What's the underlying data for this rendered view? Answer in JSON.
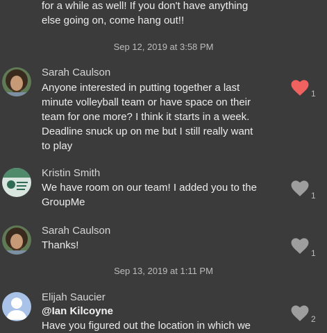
{
  "messages": [
    {
      "text_lines": [
        "for a while as well! If you don't have anything",
        "else going on, come hang out!!"
      ]
    },
    {
      "timestamp": "Sep 12, 2019 at 3:58 PM",
      "sender": "Sarah Caulson",
      "text_lines": [
        "Anyone interested in putting together a last",
        "minute volleyball team or have space on their",
        "team for one more? I think it starts in a week.",
        "Deadline snuck up on me but I still really want",
        "to play"
      ],
      "likes": "1",
      "liked": true
    },
    {
      "sender": "Kristin Smith",
      "text_lines": [
        "We have room on our team! I added you to the",
        "GroupMe"
      ],
      "likes": "1",
      "liked": false
    },
    {
      "sender": "Sarah Caulson",
      "text_lines": [
        "Thanks!"
      ],
      "likes": "1",
      "liked": false
    },
    {
      "timestamp": "Sep 13, 2019 at 1:11 PM",
      "sender": "Elijah Saucier",
      "mention": "@Ian Kilcoyne",
      "text_lines": [
        "Have you figured out the location in which we"
      ],
      "likes": "2",
      "liked": false
    }
  ],
  "colors": {
    "background": "#3b3b3b",
    "heart_liked": "#f0625f",
    "heart_unliked": "#9e9e9e"
  },
  "icons": {
    "heart": "heart-icon",
    "avatar_default": "person-icon"
  }
}
